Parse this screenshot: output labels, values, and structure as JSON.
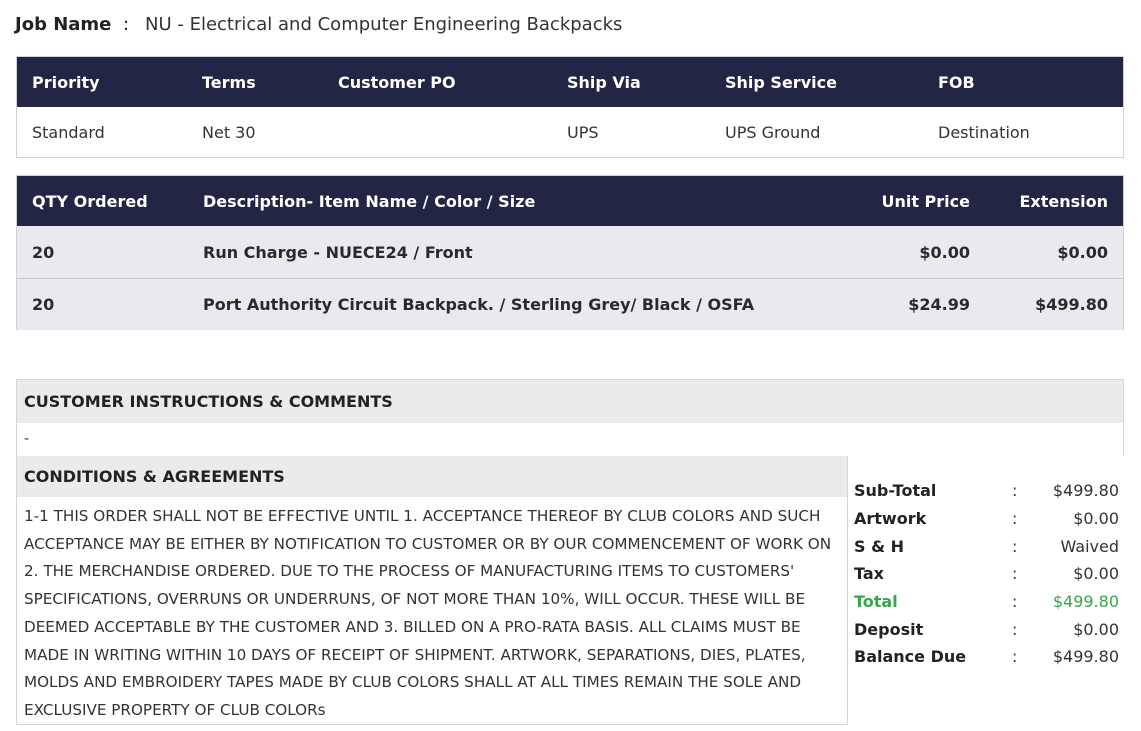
{
  "job": {
    "label": "Job Name",
    "colon": ":",
    "value": "NU - Electrical and Computer Engineering Backpacks"
  },
  "order_info": {
    "headers": [
      "Priority",
      "Terms",
      "Customer PO",
      "Ship Via",
      "Ship Service",
      "FOB"
    ],
    "values": [
      "Standard",
      "Net 30",
      "",
      "UPS",
      "UPS Ground",
      "Destination"
    ]
  },
  "items": {
    "headers": [
      "QTY Ordered",
      "Description- Item Name / Color / Size",
      "Unit Price",
      "Extension"
    ],
    "rows": [
      {
        "qty": "20",
        "description": "Run Charge - NUECE24 / Front",
        "unit_price": "$0.00",
        "extension": "$0.00"
      },
      {
        "qty": "20",
        "description": "Port Authority Circuit Backpack. / Sterling Grey/ Black / OSFA",
        "unit_price": "$24.99",
        "extension": "$499.80"
      }
    ]
  },
  "instructions": {
    "title": "CUSTOMER INSTRUCTIONS & COMMENTS",
    "body": "-"
  },
  "conditions": {
    "title": "CONDITIONS & AGREEMENTS",
    "text": "1-1 THIS ORDER SHALL NOT BE EFFECTIVE UNTIL 1. ACCEPTANCE THEREOF BY CLUB COLORS AND SUCH ACCEPTANCE MAY BE EITHER BY NOTIFICATION TO CUSTOMER OR BY OUR COMMENCEMENT OF WORK ON 2. THE MERCHANDISE ORDERED. DUE TO THE PROCESS OF MANUFACTURING ITEMS TO CUSTOMERS' SPECIFICATIONS, OVERRUNS OR UNDERRUNS, OF NOT MORE THAN 10%, WILL OCCUR. THESE WILL BE DEEMED ACCEPTABLE BY THE CUSTOMER AND 3. BILLED ON A PRO-RATA BASIS. ALL CLAIMS MUST BE MADE IN WRITING WITHIN 10 DAYS OF RECEIPT OF SHIPMENT. ARTWORK, SEPARATIONS, DIES, PLATES, MOLDS AND EMBROIDERY TAPES MADE BY CLUB COLORS SHALL AT ALL TIMES REMAIN THE SOLE AND EXCLUSIVE PROPERTY OF CLUB COLORs"
  },
  "totals": [
    {
      "label": "Sub-Total",
      "colon": ":",
      "value": "$499.80"
    },
    {
      "label": "Artwork",
      "colon": ":",
      "value": "$0.00"
    },
    {
      "label": "S & H",
      "colon": ":",
      "value": "Waived"
    },
    {
      "label": "Tax",
      "colon": ":",
      "value": "$0.00"
    },
    {
      "label": "Total",
      "colon": ":",
      "value": "$499.80"
    },
    {
      "label": "Deposit",
      "colon": ":",
      "value": "$0.00"
    },
    {
      "label": "Balance Due",
      "colon": ":",
      "value": "$499.80"
    }
  ],
  "colors": {
    "header_bg": "#232545",
    "total_green": "#36a64a",
    "row_bg": "#eaeaee",
    "section_bg": "#ebebeb"
  }
}
